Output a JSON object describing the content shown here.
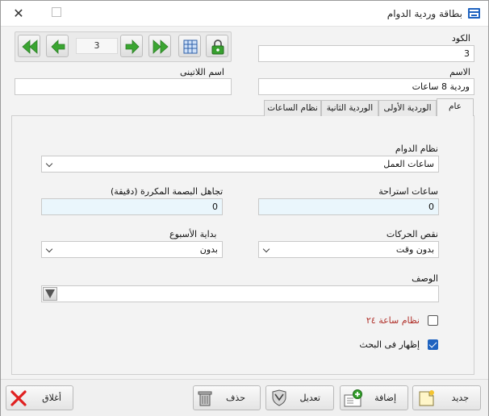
{
  "window": {
    "title": "بطاقة وردية الدوام",
    "close_glyph": "✕"
  },
  "navigator": {
    "counter": "3"
  },
  "fields": {
    "code_label": "الكود",
    "code_value": "3",
    "name_label": "الاسم",
    "name_value": "وردية 8 ساعات",
    "latin_name_label": "اسم اللاتينى",
    "latin_name_value": ""
  },
  "tabs": [
    {
      "label": "عام",
      "active": true
    },
    {
      "label": "الوردية الأولى",
      "active": false
    },
    {
      "label": "الوردية الثانية",
      "active": false
    },
    {
      "label": "نظام الساعات",
      "active": false
    }
  ],
  "general": {
    "shift_system_label": "نظام الدوام",
    "shift_system_value": "ساعات العمل",
    "break_hours_label": "ساعات استراحة",
    "break_hours_value": "0",
    "ignore_repeat_label": "تجاهل البصمة المكررة (دقيقة)",
    "ignore_repeat_value": "0",
    "moves_shortage_label": "نقص الحركات",
    "moves_shortage_value": "بدون وقت",
    "week_start_label": "بداية الأسبوع",
    "week_start_value": "بدون",
    "description_label": "الوصف",
    "description_value": "",
    "system24_label": "نظام ساعة ٢٤",
    "system24_checked": false,
    "show_in_search_label": "إظهار فى البحث",
    "show_in_search_checked": true
  },
  "actions": {
    "new_label": "جديد",
    "add_label": "إضافة",
    "edit_label": "تعديل",
    "delete_label": "حذف",
    "close_label": "أغلاق"
  },
  "colors": {
    "accent": "#1f63c0",
    "nav_green": "#3aa531",
    "red_label": "#b0302a",
    "close_red": "#e02020"
  }
}
